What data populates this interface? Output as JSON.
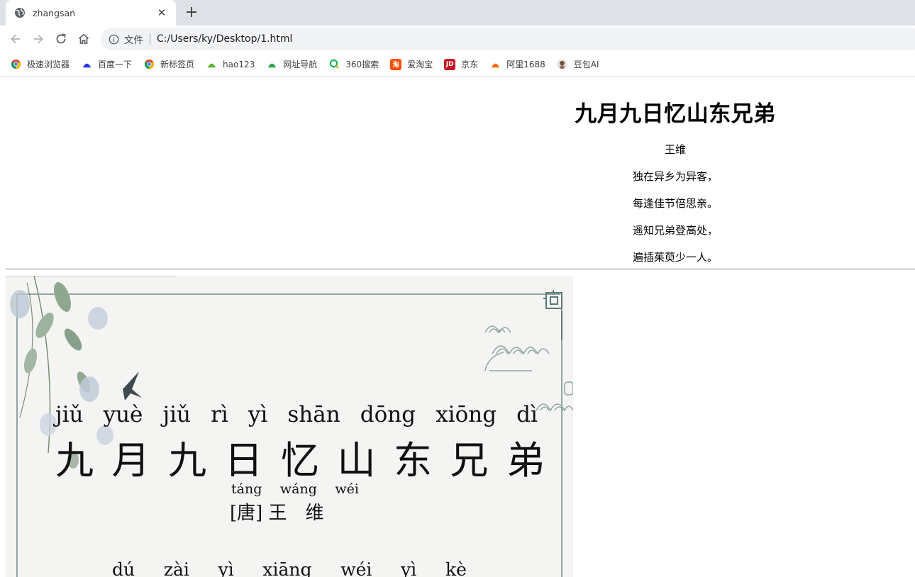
{
  "browser": {
    "tab": {
      "title": "zhangsan",
      "close_glyph": "✕"
    },
    "new_tab_glyph": "+",
    "omnibox": {
      "chip": "文件",
      "url": "C:/Users/ky/Desktop/1.html"
    },
    "bookmarks": [
      {
        "label": "极速浏览器",
        "icon": "chrome-icon",
        "color": "#db4437"
      },
      {
        "label": "百度一下",
        "icon": "baidu-paw-icon",
        "color": "#2932e1"
      },
      {
        "label": "新标签页",
        "icon": "chrome-icon",
        "color": "#0f9d58"
      },
      {
        "label": "hao123",
        "icon": "hao123-icon",
        "color": "#5cb531"
      },
      {
        "label": "网址导航",
        "icon": "nav-house-icon",
        "color": "#2ba24c"
      },
      {
        "label": "360搜索",
        "icon": "360-search-icon",
        "color": "#19b955"
      },
      {
        "label": "爱淘宝",
        "icon": "taobao-icon",
        "color": "#ff5000",
        "glyph": "淘"
      },
      {
        "label": "京东",
        "icon": "jd-icon",
        "color": "#c91623",
        "glyph": "JD"
      },
      {
        "label": "阿里1688",
        "icon": "alibaba-icon",
        "color": "#ff6a00"
      },
      {
        "label": "豆包AI",
        "icon": "doubao-avatar-icon",
        "color": "#8a6d5b"
      }
    ]
  },
  "poem": {
    "title": "九月九日忆山东兄弟",
    "author": "王维",
    "lines": [
      "独在异乡为异客，",
      "每逢佳节倍思亲。",
      "遥知兄弟登高处，",
      "遍插茱萸少一人。"
    ]
  },
  "poster": {
    "title_pinyin": [
      "jiǔ",
      "yuè",
      "jiǔ",
      "rì",
      "yì",
      "shān",
      "dōng",
      "xiōng",
      "dì"
    ],
    "title_chars": [
      "九",
      "月",
      "九",
      "日",
      "忆",
      "山",
      "东",
      "兄",
      "弟"
    ],
    "author_pinyin": [
      "táng",
      "wáng",
      "wéi"
    ],
    "author_line": "[唐] 王　维",
    "line1_pinyin": [
      "dú",
      "zài",
      "yì",
      "xiāng",
      "wéi",
      "yì",
      "kè"
    ]
  }
}
